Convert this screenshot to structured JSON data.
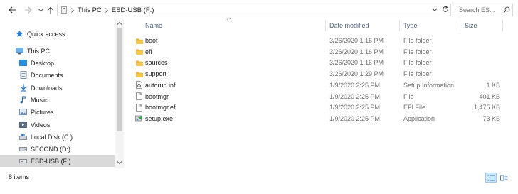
{
  "address": {
    "crumbs": [
      "This PC",
      "ESD-USB (F:)"
    ]
  },
  "search": {
    "placeholder": "Search ES..."
  },
  "sidebar": {
    "items": [
      {
        "label": "Quick access",
        "icon": "star-icon"
      },
      {
        "label": "This PC",
        "icon": "computer-icon"
      },
      {
        "label": "Desktop",
        "icon": "desktop-icon"
      },
      {
        "label": "Documents",
        "icon": "documents-icon"
      },
      {
        "label": "Downloads",
        "icon": "download-icon"
      },
      {
        "label": "Music",
        "icon": "music-icon"
      },
      {
        "label": "Pictures",
        "icon": "pictures-icon"
      },
      {
        "label": "Videos",
        "icon": "videos-icon"
      },
      {
        "label": "Local Disk (C:)",
        "icon": "drive-icon"
      },
      {
        "label": "SECOND (D:)",
        "icon": "drive-icon"
      },
      {
        "label": "ESD-USB (F:)",
        "icon": "usb-drive-icon"
      }
    ]
  },
  "columns": {
    "name": "Name",
    "date": "Date modified",
    "type": "Type",
    "size": "Size"
  },
  "files": [
    {
      "name": "boot",
      "date": "3/26/2020 1:16 PM",
      "type": "File folder",
      "size": "",
      "icon": "folder-icon"
    },
    {
      "name": "efi",
      "date": "3/26/2020 1:16 PM",
      "type": "File folder",
      "size": "",
      "icon": "folder-icon"
    },
    {
      "name": "sources",
      "date": "3/26/2020 1:16 PM",
      "type": "File folder",
      "size": "",
      "icon": "folder-icon"
    },
    {
      "name": "support",
      "date": "3/26/2020 1:29 PM",
      "type": "File folder",
      "size": "",
      "icon": "folder-icon"
    },
    {
      "name": "autorun.inf",
      "date": "1/9/2020 2:25 PM",
      "type": "Setup Information",
      "size": "1 KB",
      "icon": "settings-file-icon"
    },
    {
      "name": "bootmgr",
      "date": "1/9/2020 2:25 PM",
      "type": "File",
      "size": "401 KB",
      "icon": "file-icon"
    },
    {
      "name": "bootmgr.efi",
      "date": "1/9/2020 2:25 PM",
      "type": "EFI File",
      "size": "1,475 KB",
      "icon": "file-icon"
    },
    {
      "name": "setup.exe",
      "date": "1/9/2020 2:25 PM",
      "type": "Application",
      "size": "73 KB",
      "icon": "setup-exe-icon"
    }
  ],
  "status": {
    "item_count": "8 items"
  },
  "colors": {
    "folder": "#e8b53a",
    "header_text": "#4c607a",
    "selected_bg": "#d9d9d9",
    "view_active": "#cce8ff"
  }
}
